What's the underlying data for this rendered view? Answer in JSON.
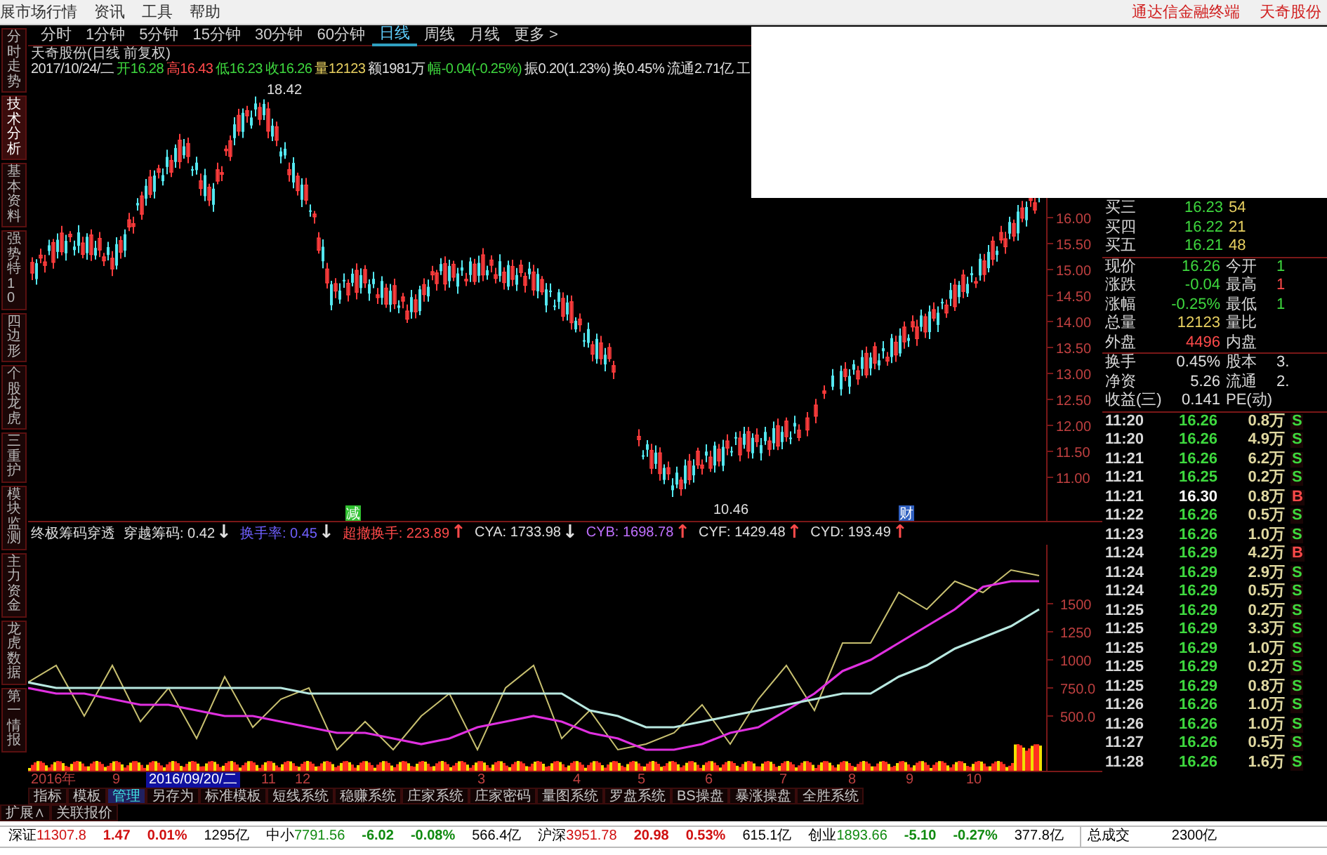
{
  "menu_bar": {
    "items": [
      "展市场行情",
      "资讯",
      "工具",
      "帮助"
    ],
    "links": [
      "通达信金融终端",
      "天奇股份"
    ]
  },
  "side_tabs": [
    {
      "label": "分时走势",
      "selected": false
    },
    {
      "label": "技术分析",
      "selected": true
    },
    {
      "label": "基本资料",
      "selected": false
    },
    {
      "label": "强势特10",
      "selected": false
    },
    {
      "label": "四边形",
      "selected": false
    },
    {
      "label": "个股龙虎",
      "selected": false
    },
    {
      "label": "三重护",
      "selected": false
    },
    {
      "label": "模块监测",
      "selected": false
    },
    {
      "label": "主力资金",
      "selected": false
    },
    {
      "label": "龙虎数据",
      "selected": false
    },
    {
      "label": "第一情报",
      "selected": false
    }
  ],
  "period_tabs": [
    {
      "label": "分时",
      "selected": false
    },
    {
      "label": "1分钟",
      "selected": false
    },
    {
      "label": "5分钟",
      "selected": false
    },
    {
      "label": "15分钟",
      "selected": false
    },
    {
      "label": "30分钟",
      "selected": false
    },
    {
      "label": "60分钟",
      "selected": false
    },
    {
      "label": "日线",
      "selected": true
    },
    {
      "label": "周线",
      "selected": false
    },
    {
      "label": "月线",
      "selected": false
    },
    {
      "label": "更多 >",
      "selected": false
    }
  ],
  "quote_header": {
    "title": "天奇股份(日线 前复权)",
    "items": [
      {
        "text": "2017/10/24/二",
        "color": "#e0e0e0"
      },
      {
        "text": "开16.28",
        "color": "#3ed83e"
      },
      {
        "text": "高16.43",
        "color": "#ff4a4a"
      },
      {
        "text": "低16.23",
        "color": "#3ed83e"
      },
      {
        "text": "收16.26",
        "color": "#3ed83e"
      },
      {
        "text": "量12123",
        "color": "#e8d060"
      },
      {
        "text": "额1981万",
        "color": "#e0e0e0"
      },
      {
        "text": "幅-0.04(-0.25%)",
        "color": "#3ed83e"
      },
      {
        "text": "振0.20(1.23%)",
        "color": "#e0e0e0"
      },
      {
        "text": "换0.45%",
        "color": "#e0e0e0"
      },
      {
        "text": "流通2.71亿",
        "color": "#e0e0e0"
      },
      {
        "text": "工",
        "color": "#e0e0e0"
      }
    ]
  },
  "price_chart": {
    "axis_labels": [
      "16.00",
      "15.50",
      "15.00",
      "14.50",
      "14.00",
      "13.50",
      "13.00",
      "12.50",
      "12.00",
      "11.50",
      "11.00"
    ],
    "high_label": "18.42",
    "low_label": "10.46",
    "markers": [
      {
        "text": "减",
        "kind": "event"
      },
      {
        "text": "财",
        "kind": "finance"
      }
    ]
  },
  "indicator": {
    "title": "终极筹码穿透",
    "items": [
      {
        "text": "穿越筹码: 0.42",
        "color": "#e0e0e0",
        "arrow": {
          "text": "↓",
          "color": "#e0e0e0"
        }
      },
      {
        "text": "换手率: 0.45",
        "color": "#7060ff",
        "arrow": {
          "text": "↓",
          "color": "#e0e0e0"
        }
      },
      {
        "text": "超撤换手: 223.89",
        "color": "#ff4a4a",
        "arrow": {
          "text": "↑",
          "color": "#ff4a4a"
        }
      },
      {
        "text": "CYA: 1733.98",
        "color": "#e0e0e0",
        "arrow": {
          "text": "↓",
          "color": "#e0e0e0"
        }
      },
      {
        "text": "CYB: 1698.78",
        "color": "#c070ff",
        "arrow": {
          "text": "↑",
          "color": "#ff4a4a"
        }
      },
      {
        "text": "CYF: 1429.48",
        "color": "#e0e0e0",
        "arrow": {
          "text": "↑",
          "color": "#ff4a4a"
        }
      },
      {
        "text": "CYD: 193.49",
        "color": "#e0e0e0",
        "arrow": {
          "text": "↑",
          "color": "#ff4a4a"
        }
      }
    ],
    "chart_data": {
      "type": "line",
      "ylim": [
        0,
        2025
      ],
      "yticks": [
        {
          "value": 1500,
          "label": "1500"
        },
        {
          "value": 1250,
          "label": "1250"
        },
        {
          "value": 1000,
          "label": "1000"
        },
        {
          "value": 750,
          "label": "750.0"
        },
        {
          "value": 500,
          "label": "500.0"
        }
      ],
      "series": [
        {
          "color": "#c8c070",
          "values": [
            800,
            950,
            500,
            950,
            450,
            750,
            300,
            850,
            400,
            650,
            750,
            200,
            450,
            200,
            500,
            700,
            200,
            750,
            950,
            300,
            550,
            200,
            250,
            350,
            600,
            250,
            650,
            950,
            550,
            1150,
            1150,
            1600,
            1450,
            1700,
            1600,
            1800,
            1750
          ]
        },
        {
          "color": "#e030e0",
          "values": [
            750,
            700,
            700,
            650,
            600,
            600,
            550,
            500,
            500,
            450,
            400,
            350,
            350,
            300,
            250,
            300,
            400,
            450,
            500,
            450,
            350,
            300,
            200,
            200,
            250,
            350,
            400,
            550,
            700,
            900,
            1000,
            1150,
            1300,
            1450,
            1650,
            1700,
            1700
          ]
        },
        {
          "color": "#b8e8e0",
          "values": [
            800,
            750,
            750,
            750,
            750,
            750,
            750,
            750,
            750,
            750,
            700,
            700,
            700,
            700,
            700,
            700,
            700,
            700,
            700,
            700,
            550,
            500,
            400,
            400,
            450,
            500,
            550,
            600,
            650,
            700,
            700,
            850,
            950,
            1100,
            1200,
            1300,
            1450
          ]
        }
      ]
    }
  },
  "x_axis": [
    {
      "text": "2016年",
      "kind": "tick"
    },
    {
      "text": "9",
      "kind": "tick"
    },
    {
      "text": "2016/09/20/二",
      "kind": "cursor"
    },
    {
      "text": "11",
      "kind": "tick"
    },
    {
      "text": "12",
      "kind": "tick"
    },
    {
      "text": "3",
      "kind": "tick"
    },
    {
      "text": "4",
      "kind": "tick"
    },
    {
      "text": "5",
      "kind": "tick"
    },
    {
      "text": "6",
      "kind": "tick"
    },
    {
      "text": "7",
      "kind": "tick"
    },
    {
      "text": "8",
      "kind": "tick"
    },
    {
      "text": "9",
      "kind": "tick"
    },
    {
      "text": "10",
      "kind": "tick"
    }
  ],
  "bottom_tabs": [
    {
      "label": "指标",
      "selected": false
    },
    {
      "label": "模板",
      "selected": false
    },
    {
      "label": "管理",
      "selected": true
    },
    {
      "label": "另存为",
      "selected": false
    },
    {
      "label": "标准模板",
      "selected": false
    },
    {
      "label": "短线系统",
      "selected": false
    },
    {
      "label": "稳赚系统",
      "selected": false
    },
    {
      "label": "庄家系统",
      "selected": false
    },
    {
      "label": "庄家密码",
      "selected": false
    },
    {
      "label": "量图系统",
      "selected": false
    },
    {
      "label": "罗盘系统",
      "selected": false
    },
    {
      "label": "BS操盘",
      "selected": false
    },
    {
      "label": "暴涨操盘",
      "selected": false
    },
    {
      "label": "全胜系统",
      "selected": false
    }
  ],
  "status_tabs": [
    "扩展∧",
    "关联报价"
  ],
  "right_panel": {
    "order_book": [
      {
        "label": "买三",
        "price": "16.23",
        "volume": "54"
      },
      {
        "label": "买四",
        "price": "16.22",
        "volume": "21"
      },
      {
        "label": "买五",
        "price": "16.21",
        "volume": "48"
      }
    ],
    "quote_stats": [
      {
        "label": "现价",
        "value": "16.26",
        "color": "#3ed83e",
        "right": {
          "label": "今开",
          "value": "1",
          "color": "#3ed83e"
        }
      },
      {
        "label": "涨跌",
        "value": "-0.04",
        "color": "#3ed83e",
        "right": {
          "label": "最高",
          "value": "1",
          "color": "#ff4a4a"
        }
      },
      {
        "label": "涨幅",
        "value": "-0.25%",
        "color": "#3ed83e",
        "right": {
          "label": "最低",
          "value": "1",
          "color": "#3ed83e"
        }
      },
      {
        "label": "总量",
        "value": "12123",
        "color": "#e8d060",
        "right": {
          "label": "量比"
        }
      },
      {
        "label": "外盘",
        "value": "4496",
        "color": "#ff4a4a",
        "right": {
          "label": "内盘"
        }
      }
    ],
    "finance_stats": [
      {
        "label": "换手",
        "value": "0.45%",
        "color": "#e0e0e0",
        "right": {
          "label": "股本",
          "value": "3.",
          "color": "#e0e0e0"
        }
      },
      {
        "label": "净资",
        "value": "5.26",
        "color": "#e0e0e0",
        "right": {
          "label": "流通",
          "value": "2.",
          "color": "#e0e0e0"
        }
      },
      {
        "label": "收益(三)",
        "value": "0.141",
        "color": "#e0e0e0",
        "right": {
          "label": "PE(动)"
        }
      }
    ],
    "trades": [
      {
        "time": "11:20",
        "price": "16.26",
        "color": "#3ed83e",
        "volume": "0.8万",
        "side": {
          "text": "S",
          "color": "#3ed83e"
        }
      },
      {
        "time": "11:20",
        "price": "16.26",
        "color": "#3ed83e",
        "volume": "4.9万",
        "side": {
          "text": "S",
          "color": "#3ed83e"
        }
      },
      {
        "time": "11:21",
        "price": "16.26",
        "color": "#3ed83e",
        "volume": "6.2万",
        "side": {
          "text": "S",
          "color": "#3ed83e"
        }
      },
      {
        "time": "11:21",
        "price": "16.25",
        "color": "#3ed83e",
        "volume": "0.2万",
        "side": {
          "text": "S",
          "color": "#3ed83e"
        }
      },
      {
        "time": "11:21",
        "price": "16.30",
        "color": "#ffffff",
        "volume": "0.8万",
        "side": {
          "text": "B",
          "color": "#ff4a4a"
        }
      },
      {
        "time": "11:22",
        "price": "16.26",
        "color": "#3ed83e",
        "volume": "0.5万",
        "side": {
          "text": "S",
          "color": "#3ed83e"
        }
      },
      {
        "time": "11:23",
        "price": "16.26",
        "color": "#3ed83e",
        "volume": "1.0万",
        "side": {
          "text": "S",
          "color": "#3ed83e"
        }
      },
      {
        "time": "11:24",
        "price": "16.29",
        "color": "#3ed83e",
        "volume": "4.2万",
        "side": {
          "text": "B",
          "color": "#ff4a4a"
        }
      },
      {
        "time": "11:24",
        "price": "16.29",
        "color": "#3ed83e",
        "volume": "2.9万",
        "side": {
          "text": "S",
          "color": "#3ed83e"
        }
      },
      {
        "time": "11:24",
        "price": "16.29",
        "color": "#3ed83e",
        "volume": "0.5万",
        "side": {
          "text": "S",
          "color": "#3ed83e"
        }
      },
      {
        "time": "11:25",
        "price": "16.29",
        "color": "#3ed83e",
        "volume": "0.2万",
        "side": {
          "text": "S",
          "color": "#3ed83e"
        }
      },
      {
        "time": "11:25",
        "price": "16.29",
        "color": "#3ed83e",
        "volume": "3.3万",
        "side": {
          "text": "S",
          "color": "#3ed83e"
        }
      },
      {
        "time": "11:25",
        "price": "16.29",
        "color": "#3ed83e",
        "volume": "1.0万",
        "side": {
          "text": "S",
          "color": "#3ed83e"
        }
      },
      {
        "time": "11:25",
        "price": "16.29",
        "color": "#3ed83e",
        "volume": "0.2万",
        "side": {
          "text": "S",
          "color": "#3ed83e"
        }
      },
      {
        "time": "11:25",
        "price": "16.29",
        "color": "#3ed83e",
        "volume": "0.8万",
        "side": {
          "text": "S",
          "color": "#3ed83e"
        }
      },
      {
        "time": "11:26",
        "price": "16.26",
        "color": "#3ed83e",
        "volume": "1.0万",
        "side": {
          "text": "S",
          "color": "#3ed83e"
        }
      },
      {
        "time": "11:26",
        "price": "16.26",
        "color": "#3ed83e",
        "volume": "1.0万",
        "side": {
          "text": "S",
          "color": "#3ed83e"
        }
      },
      {
        "time": "11:27",
        "price": "16.26",
        "color": "#3ed83e",
        "volume": "0.5万",
        "side": {
          "text": "S",
          "color": "#3ed83e"
        }
      },
      {
        "time": "11:28",
        "price": "16.26",
        "color": "#3ed83e",
        "volume": "1.6万",
        "side": {
          "text": "S",
          "color": "#3ed83e"
        }
      }
    ]
  },
  "market_bar": {
    "indices": [
      {
        "name": "深证",
        "index": "11307.8",
        "change": "1.47",
        "pct": "0.01%",
        "amount": "1295亿",
        "color": "#d01010"
      },
      {
        "name": "中小",
        "index": "7791.56",
        "change": "-6.02",
        "pct": "-0.08%",
        "amount": "566.4亿",
        "color": "#108a10"
      },
      {
        "name": "沪深",
        "index": "3951.78",
        "change": "20.98",
        "pct": "0.53%",
        "amount": "615.1亿",
        "color": "#d01010"
      },
      {
        "name": "创业",
        "index": "1893.66",
        "change": "-5.10",
        "pct": "-0.27%",
        "amount": "377.8亿",
        "color": "#108a10"
      }
    ],
    "total": {
      "label": "总成交",
      "value": "2300亿"
    }
  }
}
